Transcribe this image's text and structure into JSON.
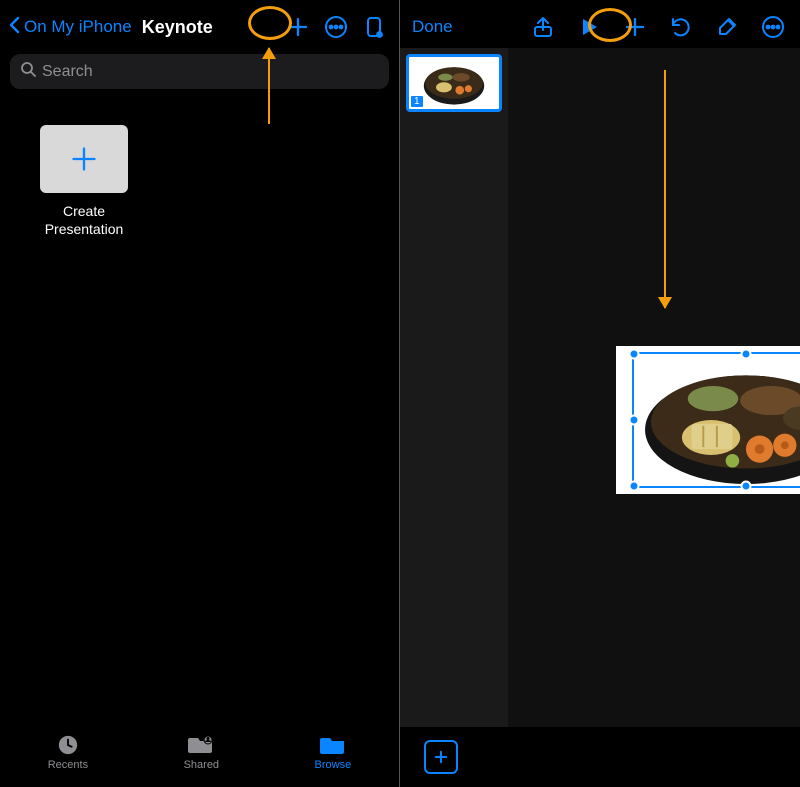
{
  "left": {
    "back_label": "On My iPhone",
    "title": "Keynote",
    "search_placeholder": "Search",
    "create_label_l1": "Create",
    "create_label_l2": "Presentation",
    "tabs": {
      "recents": "Recents",
      "shared": "Shared",
      "browse": "Browse"
    }
  },
  "right": {
    "done_label": "Done",
    "slides": [
      {
        "index": "1"
      }
    ]
  }
}
